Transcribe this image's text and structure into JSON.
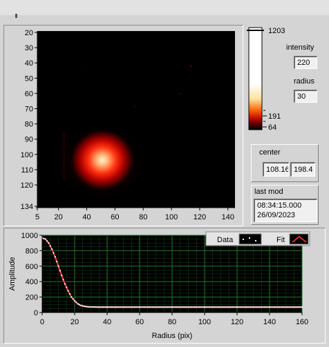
{
  "image_graph": {
    "y_ticks": [
      "20",
      "30",
      "40",
      "50",
      "60",
      "70",
      "80",
      "90",
      "100",
      "110",
      "120",
      "134"
    ],
    "x_ticks": [
      "5",
      "20",
      "40",
      "60",
      "80",
      "100",
      "120",
      "140"
    ]
  },
  "colorbar": {
    "max_label": "1203",
    "mid_label": "191",
    "min_label": "64"
  },
  "controls": {
    "intensity_label": "intensity",
    "intensity_value": "220",
    "radius_label": "radius",
    "radius_value": "30",
    "center_label": "center",
    "center_x": "108.16",
    "center_y": "198.4",
    "last_mod_label": "last mod",
    "last_mod_time": "08:34:15.000",
    "last_mod_date": "26/09/2023"
  },
  "legend": {
    "data_label": "Data",
    "fit_label": "Fit"
  },
  "chart_data": {
    "type": "line",
    "xlabel": "Radius (pix)",
    "ylabel": "Amplitude",
    "xlim": [
      0,
      160
    ],
    "ylim": [
      0,
      1000
    ],
    "x_ticks": [
      "0",
      "20",
      "40",
      "60",
      "80",
      "100",
      "120",
      "140",
      "160"
    ],
    "y_ticks": [
      "0",
      "200",
      "400",
      "600",
      "800",
      "1000"
    ],
    "grid": true,
    "background": "#000000",
    "grid_color": "#1f7a2a",
    "series": [
      {
        "name": "Data",
        "color": "#ffffff",
        "x": [
          0,
          2,
          4,
          6,
          8,
          10,
          12,
          14,
          16,
          18,
          20,
          22,
          24,
          26,
          28,
          30,
          35,
          40,
          50,
          60,
          80,
          100,
          120,
          140,
          160
        ],
        "y": [
          965,
          950,
          900,
          820,
          720,
          600,
          480,
          370,
          280,
          200,
          150,
          112,
          90,
          80,
          74,
          72,
          70,
          70,
          70,
          70,
          70,
          70,
          70,
          70,
          70
        ]
      },
      {
        "name": "Fit",
        "color": "#ff3b3b",
        "x": [
          0,
          2,
          4,
          6,
          8,
          10,
          12,
          14,
          16,
          18,
          20,
          22,
          24,
          26,
          28,
          30,
          35,
          40,
          50,
          60,
          80,
          100,
          120,
          140,
          160
        ],
        "y": [
          965,
          950,
          900,
          820,
          720,
          600,
          480,
          370,
          280,
          200,
          150,
          112,
          90,
          80,
          74,
          72,
          70,
          70,
          70,
          70,
          70,
          70,
          70,
          70,
          70
        ]
      }
    ]
  }
}
